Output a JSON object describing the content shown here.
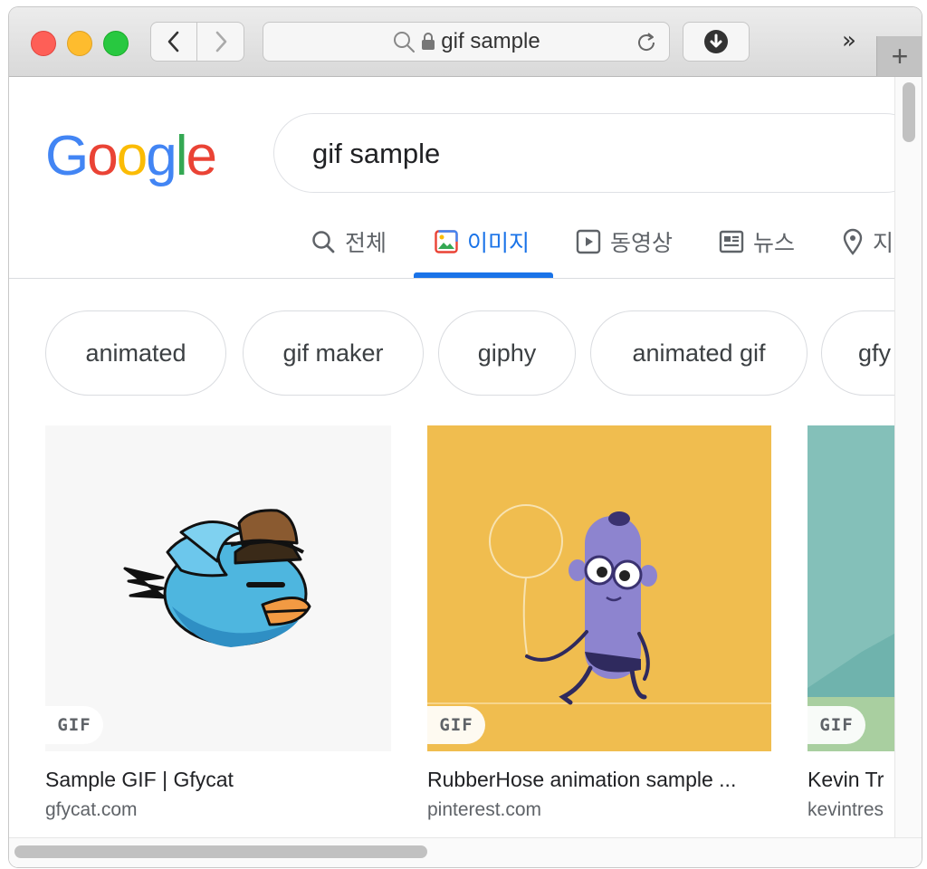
{
  "browser": {
    "url_text": "gif sample",
    "icons": {
      "back": "chevron-left-icon",
      "forward": "chevron-right-icon",
      "search": "magnifier-icon",
      "lock": "lock-icon",
      "reload": "reload-icon",
      "download": "download-icon",
      "more_tabs": "double-chevron-icon",
      "new_tab": "plus-icon"
    },
    "more_tabs_glyph": "»",
    "new_tab_glyph": "+"
  },
  "google": {
    "logo_letters": [
      "G",
      "o",
      "o",
      "g",
      "l",
      "e"
    ],
    "logo_colors": [
      "#4285F4",
      "#EA4335",
      "#FBBC05",
      "#4285F4",
      "#34A853",
      "#EA4335"
    ],
    "query": "gif sample"
  },
  "tabs": [
    {
      "label": "전체",
      "icon": "search-icon",
      "active": false
    },
    {
      "label": "이미지",
      "icon": "image-icon",
      "active": true
    },
    {
      "label": "동영상",
      "icon": "video-icon",
      "active": false
    },
    {
      "label": "뉴스",
      "icon": "news-icon",
      "active": false
    },
    {
      "label": "지",
      "icon": "map-pin-icon",
      "active": false
    }
  ],
  "accent_color": "#1a73e8",
  "chips": [
    "animated",
    "gif maker",
    "giphy",
    "animated gif",
    "gfy"
  ],
  "results": [
    {
      "title": "Sample GIF | Gfycat",
      "source": "gfycat.com",
      "badge": "GIF"
    },
    {
      "title": "RubberHose animation sample ...",
      "source": "pinterest.com",
      "badge": "GIF"
    },
    {
      "title": "Kevin Tr",
      "source": "kevintres",
      "badge": "GIF"
    }
  ]
}
